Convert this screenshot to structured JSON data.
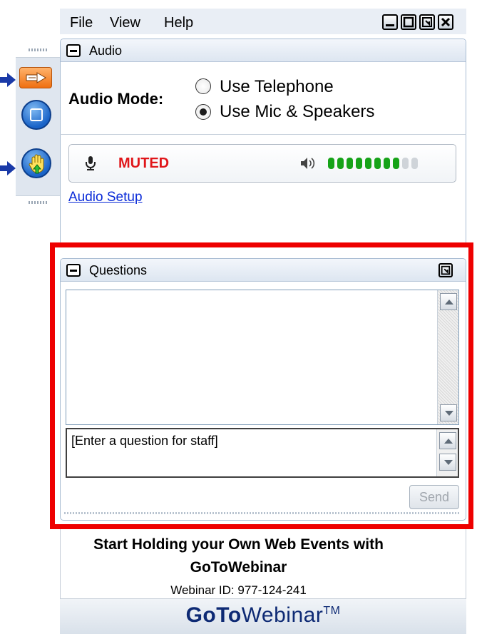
{
  "menu": {
    "file": "File",
    "view": "View",
    "help": "Help"
  },
  "audio": {
    "title": "Audio",
    "mode_label": "Audio Mode:",
    "options": [
      {
        "label": "Use Telephone",
        "selected": false
      },
      {
        "label": "Use Mic & Speakers",
        "selected": true
      }
    ],
    "status": "MUTED",
    "speaker_level": {
      "filled": 8,
      "total": 10
    },
    "setup_link": "Audio Setup"
  },
  "questions": {
    "title": "Questions",
    "input_placeholder": "[Enter a question for staff]",
    "send_label": "Send"
  },
  "promo": {
    "line1": "Start Holding your Own Web Events with",
    "line2": "GoToWebinar",
    "webinar_id": "Webinar ID: 977-124-241"
  },
  "footer": {
    "logo_bold": "GoTo",
    "logo_rest": "Webinar",
    "logo_tm": "TM"
  },
  "colors": {
    "muted": "#e0161a",
    "level_on": "#16a318",
    "level_off": "#cfd4d9",
    "highlight_frame": "#ee0000",
    "accent": "#0e2a74"
  }
}
